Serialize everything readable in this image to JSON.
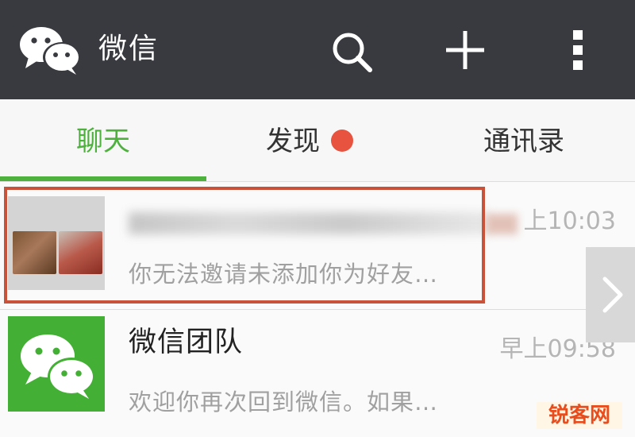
{
  "header": {
    "title": "微信"
  },
  "tabs": [
    {
      "label": "聊天"
    },
    {
      "label": "发现"
    },
    {
      "label": "通讯录"
    }
  ],
  "chats": [
    {
      "time": "上10:03",
      "preview": "你无法邀请未添加你为好友…"
    },
    {
      "name": "微信团队",
      "time": "早上09:58",
      "preview": "欢迎你再次回到微信。如果…"
    }
  ],
  "watermark": "锐客网",
  "colors": {
    "header_bg": "#393a3f",
    "accent_green": "#4eb13e",
    "badge_red": "#e8533f",
    "highlight": "#c8533a"
  }
}
